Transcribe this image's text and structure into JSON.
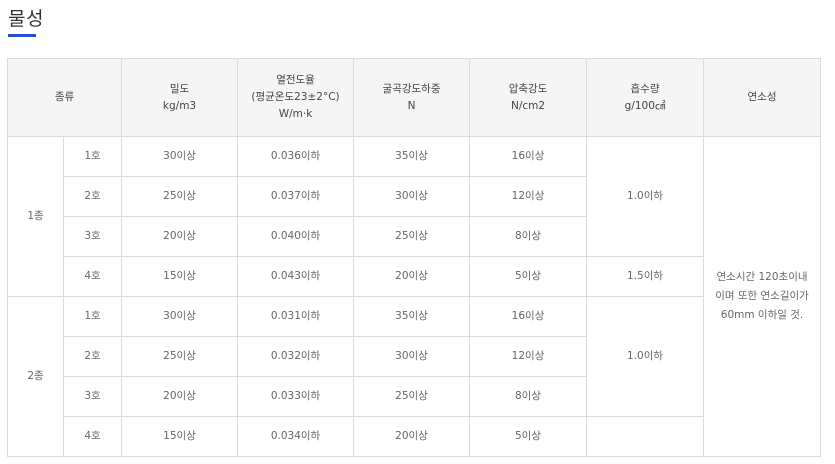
{
  "page_title": "물성",
  "table": {
    "headers": [
      {
        "lines": [
          "종류"
        ]
      },
      {
        "lines": [
          "밀도",
          "kg/m3"
        ]
      },
      {
        "lines": [
          "열전도율",
          "(평균온도23±2°C)",
          "W/m·k"
        ]
      },
      {
        "lines": [
          "굴곡강도하중",
          "N"
        ]
      },
      {
        "lines": [
          "압축강도",
          "N/cm2"
        ]
      },
      {
        "lines": [
          "흡수량",
          "g/100㎠"
        ]
      },
      {
        "lines": [
          "연소성"
        ]
      }
    ],
    "groups": [
      "1종",
      "2종"
    ],
    "rows": [
      {
        "sub": "1호",
        "density": "30이상",
        "conductivity": "0.036이하",
        "bending": "35이상",
        "compressive": "16이상"
      },
      {
        "sub": "2호",
        "density": "25이상",
        "conductivity": "0.037이하",
        "bending": "30이상",
        "compressive": "12이상"
      },
      {
        "sub": "3호",
        "density": "20이상",
        "conductivity": "0.040이하",
        "bending": "25이상",
        "compressive": "8이상"
      },
      {
        "sub": "4호",
        "density": "15이상",
        "conductivity": "0.043이하",
        "bending": "20이상",
        "compressive": "5이상"
      },
      {
        "sub": "1호",
        "density": "30이상",
        "conductivity": "0.031이하",
        "bending": "35이상",
        "compressive": "16이상"
      },
      {
        "sub": "2호",
        "density": "25이상",
        "conductivity": "0.032이하",
        "bending": "30이상",
        "compressive": "12이상"
      },
      {
        "sub": "3호",
        "density": "20이상",
        "conductivity": "0.033이하",
        "bending": "25이상",
        "compressive": "8이상"
      },
      {
        "sub": "4호",
        "density": "15이상",
        "conductivity": "0.034이하",
        "bending": "20이상",
        "compressive": "5이상"
      }
    ],
    "absorption": [
      "1.0이하",
      "1.5이하",
      "1.0이하"
    ],
    "combustibility": [
      "연소시간 120초이내",
      "이며 또한 연소길이가",
      "60mm 이하일 것."
    ]
  }
}
